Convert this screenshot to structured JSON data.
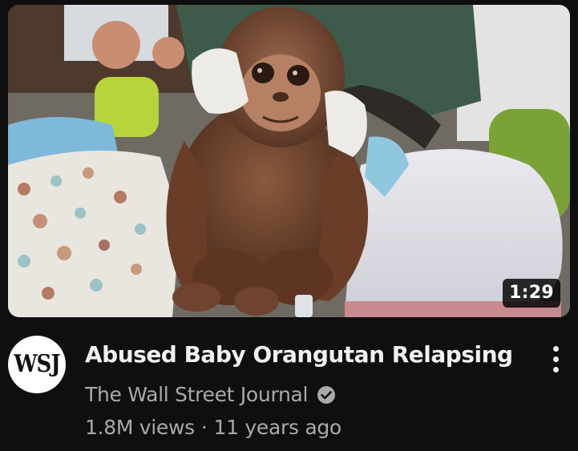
{
  "video": {
    "duration": "1:29",
    "title": "Abused Baby Orangutan Relapsing",
    "channel": {
      "name": "The Wall Street Journal",
      "avatar_text": "WSJ",
      "verified": true
    },
    "views": "1.8M views",
    "separator": "·",
    "age": "11 years ago"
  },
  "icons": {
    "verified": "check-circle-icon",
    "menu": "more-vert-icon"
  },
  "colors": {
    "background": "#0f0f0f",
    "title": "#f1f1f1",
    "secondary": "#aaaaaa"
  }
}
